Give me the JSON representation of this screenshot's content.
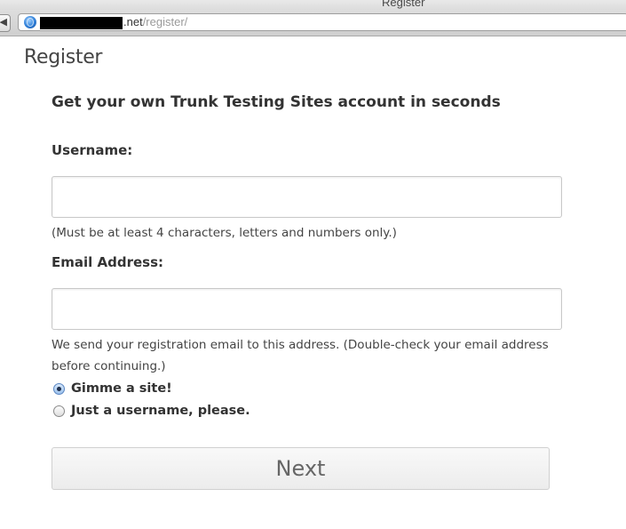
{
  "window": {
    "title": "Register"
  },
  "browser": {
    "url_domain": ".net",
    "url_path": "/register/",
    "favicon": "globe-icon"
  },
  "page": {
    "title": "Register",
    "subtitle": "Get your own Trunk Testing Sites account in seconds"
  },
  "form": {
    "username": {
      "label": "Username:",
      "value": "",
      "hint": "(Must be at least 4 characters, letters and numbers only.)"
    },
    "email": {
      "label": "Email Address:",
      "value": "",
      "hint": "We send your registration email to this address. (Double-check your email address before continuing.)"
    },
    "options": [
      {
        "label": "Gimme a site!",
        "checked": true
      },
      {
        "label": "Just a username, please.",
        "checked": false
      }
    ],
    "submit_label": "Next"
  }
}
